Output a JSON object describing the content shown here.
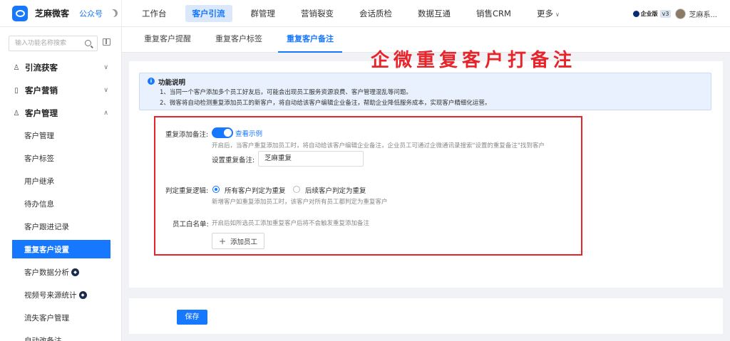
{
  "app": {
    "name": "芝麻微客",
    "sub": "公众号"
  },
  "nav": [
    "工作台",
    "客户引流",
    "群管理",
    "营销裂变",
    "会话质检",
    "数据互通",
    "销售CRM",
    "更多"
  ],
  "header_right": {
    "edition": "企业版",
    "version": "v3",
    "user": "芝麻系..."
  },
  "sidebar": {
    "search_placeholder": "输入功能名称搜索",
    "groups": [
      {
        "label": "引流获客",
        "icon": "user-plus-icon"
      },
      {
        "label": "客户营销",
        "icon": "book-icon"
      },
      {
        "label": "客户管理",
        "icon": "user-settings-icon"
      }
    ],
    "items": [
      "客户管理",
      "客户标签",
      "用户继承",
      "待办信息",
      "客户跟进记录",
      "重复客户设置",
      "客户数据分析",
      "视频号来源统计",
      "流失客户管理",
      "自动改备注"
    ]
  },
  "tabs": [
    "重复客户提醒",
    "重复客户标签",
    "重复客户备注"
  ],
  "annotation": "企微重复客户打备注",
  "info": {
    "title": "功能说明",
    "line1": "1、当同一个客户添加多个员工好友后，可能会出现员工服务资源浪费、客户管理混乱等问题。",
    "line2": "2、微客将自动检测重复添加员工的新客户，将自动给该客户编辑企业备注，帮助企业降低服务成本，实现客户精细化运营。"
  },
  "form": {
    "repeat_note_label": "重复添加备注:",
    "example_link": "查看示例",
    "repeat_note_hint": "开启后，当客户重复添加员工时，将自动给该客户编辑企业备注，企业员工可通过企微通讯录搜索\"设置的重复备注\"找到客户",
    "set_note_label": "设置重复备注:",
    "note_value": "芝麻重复",
    "logic_label": "判定重复逻辑:",
    "logic_option_all": "所有客户判定为重复",
    "logic_option_later": "后续客户判定为重复",
    "logic_hint": "新增客户如重复添加员工时，该客户对所有员工都判定为重复客户",
    "whitelist_label": "员工白名单:",
    "whitelist_hint": "开启后如所选员工添加重复客户后将不会触发重复添加备注",
    "add_staff": "添加员工"
  },
  "save": "保存",
  "colors": {
    "accent": "#1677ff",
    "annotation_red": "#e8242b"
  }
}
